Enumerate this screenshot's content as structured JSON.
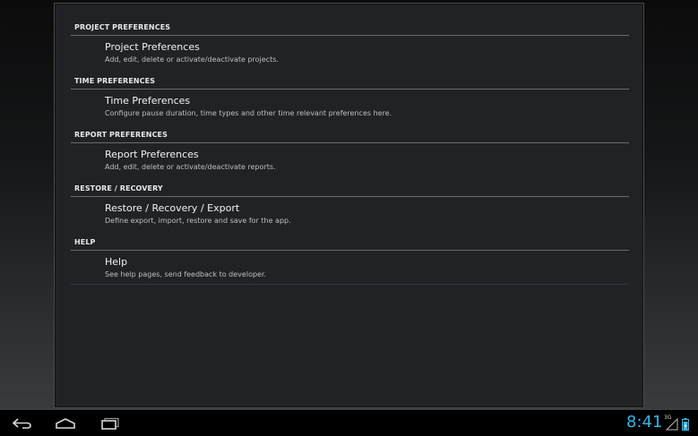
{
  "categories": [
    {
      "header": "PROJECT PREFERENCES",
      "title": "Project Preferences",
      "summary": "Add, edit, delete or activate/deactivate projects."
    },
    {
      "header": "TIME PREFERENCES",
      "title": "Time Preferences",
      "summary": "Configure pause duration, time types and other time relevant preferences here."
    },
    {
      "header": "REPORT PREFERENCES",
      "title": "Report Preferences",
      "summary": "Add, edit, delete or activate/deactivate reports."
    },
    {
      "header": "RESTORE / RECOVERY",
      "title": "Restore / Recovery / Export",
      "summary": "Define export, import, restore and save for the app."
    },
    {
      "header": "HELP",
      "title": "Help",
      "summary": "See help pages, send feedback to developer."
    }
  ],
  "navbar": {
    "icons": [
      "back-icon",
      "home-icon",
      "recent-apps-icon"
    ]
  },
  "status": {
    "clock": "8:41",
    "network": "3G",
    "icons": [
      "signal-icon",
      "battery-icon"
    ]
  },
  "colors": {
    "accent": "#33b5e5",
    "dialog_bg": "#212225"
  }
}
